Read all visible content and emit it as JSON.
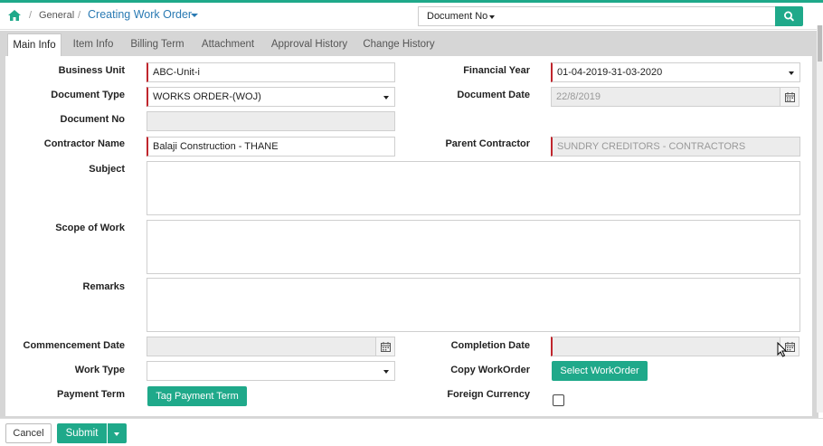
{
  "colors": {
    "accent": "#1fa98a",
    "link": "#2a7ab3",
    "required": "#c0262d"
  },
  "breadcrumb": {
    "separator": "/",
    "section": "General",
    "current": "Creating Work Order"
  },
  "search": {
    "selector_label": "Document No",
    "query": "",
    "button_icon": "search-icon"
  },
  "tabs": [
    {
      "label": "Main Info",
      "active": true
    },
    {
      "label": "Item Info",
      "active": false
    },
    {
      "label": "Billing Term",
      "active": false
    },
    {
      "label": "Attachment",
      "active": false
    },
    {
      "label": "Approval History",
      "active": false
    },
    {
      "label": "Change History",
      "active": false
    }
  ],
  "form": {
    "business_unit": {
      "label": "Business Unit",
      "value": "ABC-Unit-i"
    },
    "financial_year": {
      "label": "Financial Year",
      "value": "01-04-2019-31-03-2020"
    },
    "document_type": {
      "label": "Document Type",
      "value": "WORKS ORDER-(WOJ)"
    },
    "document_date": {
      "label": "Document Date",
      "value": "22/8/2019"
    },
    "document_no": {
      "label": "Document No",
      "value": ""
    },
    "contractor_name": {
      "label": "Contractor Name",
      "value": "Balaji Construction - THANE"
    },
    "parent_contractor": {
      "label": "Parent Contractor",
      "value": "SUNDRY CREDITORS - CONTRACTORS"
    },
    "subject": {
      "label": "Subject",
      "value": ""
    },
    "scope_of_work": {
      "label": "Scope of Work",
      "value": ""
    },
    "remarks": {
      "label": "Remarks",
      "value": ""
    },
    "commencement_date": {
      "label": "Commencement Date",
      "value": ""
    },
    "completion_date": {
      "label": "Completion Date",
      "value": ""
    },
    "work_type": {
      "label": "Work Type",
      "value": ""
    },
    "copy_workorder": {
      "label": "Copy WorkOrder",
      "button": "Select WorkOrder"
    },
    "payment_term": {
      "label": "Payment Term",
      "button": "Tag Payment Term"
    },
    "foreign_currency": {
      "label": "Foreign Currency",
      "checked": false
    }
  },
  "footer": {
    "cancel": "Cancel",
    "submit": "Submit"
  }
}
